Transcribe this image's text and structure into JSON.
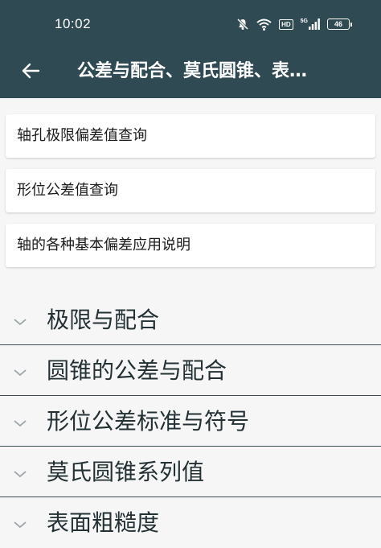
{
  "status_bar": {
    "time": "10:02",
    "hd": "HD",
    "network": "5G",
    "battery": "46"
  },
  "app_bar": {
    "title": "公差与配合、莫氏圆锥、表…"
  },
  "links": [
    {
      "label": "轴孔极限偏差值查询"
    },
    {
      "label": "形位公差值查询"
    },
    {
      "label": "轴的各种基本偏差应用说明"
    }
  ],
  "sections": [
    {
      "label": "极限与配合"
    },
    {
      "label": "圆锥的公差与配合"
    },
    {
      "label": "形位公差标准与符号"
    },
    {
      "label": "莫氏圆锥系列值"
    },
    {
      "label": "表面粗糙度"
    }
  ],
  "colors": {
    "app_bar": "#2f4a52",
    "background": "#f6f6f6",
    "divider": "#3a4d53"
  },
  "icons": {
    "back": "arrow-left-icon",
    "expand": "chevron-down-icon",
    "mute": "bell-off-icon",
    "wifi": "wifi-icon",
    "signal": "signal-icon",
    "battery": "battery-icon"
  }
}
